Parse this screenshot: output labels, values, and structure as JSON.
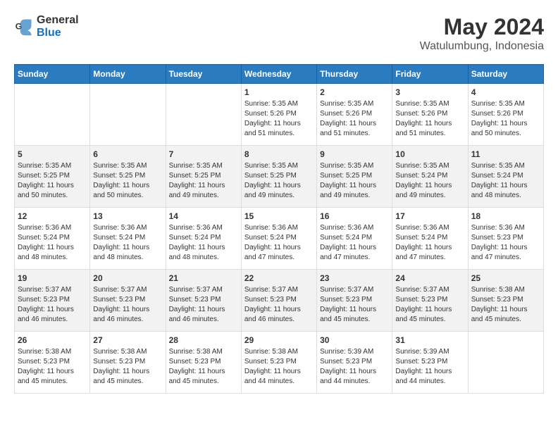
{
  "logo": {
    "general": "General",
    "blue": "Blue"
  },
  "title": "May 2024",
  "subtitle": "Watulumbung, Indonesia",
  "days": [
    "Sunday",
    "Monday",
    "Tuesday",
    "Wednesday",
    "Thursday",
    "Friday",
    "Saturday"
  ],
  "weeks": [
    [
      {
        "day": "",
        "info": ""
      },
      {
        "day": "",
        "info": ""
      },
      {
        "day": "",
        "info": ""
      },
      {
        "day": "1",
        "info": "Sunrise: 5:35 AM\nSunset: 5:26 PM\nDaylight: 11 hours\nand 51 minutes."
      },
      {
        "day": "2",
        "info": "Sunrise: 5:35 AM\nSunset: 5:26 PM\nDaylight: 11 hours\nand 51 minutes."
      },
      {
        "day": "3",
        "info": "Sunrise: 5:35 AM\nSunset: 5:26 PM\nDaylight: 11 hours\nand 51 minutes."
      },
      {
        "day": "4",
        "info": "Sunrise: 5:35 AM\nSunset: 5:26 PM\nDaylight: 11 hours\nand 50 minutes."
      }
    ],
    [
      {
        "day": "5",
        "info": "Sunrise: 5:35 AM\nSunset: 5:25 PM\nDaylight: 11 hours\nand 50 minutes."
      },
      {
        "day": "6",
        "info": "Sunrise: 5:35 AM\nSunset: 5:25 PM\nDaylight: 11 hours\nand 50 minutes."
      },
      {
        "day": "7",
        "info": "Sunrise: 5:35 AM\nSunset: 5:25 PM\nDaylight: 11 hours\nand 49 minutes."
      },
      {
        "day": "8",
        "info": "Sunrise: 5:35 AM\nSunset: 5:25 PM\nDaylight: 11 hours\nand 49 minutes."
      },
      {
        "day": "9",
        "info": "Sunrise: 5:35 AM\nSunset: 5:25 PM\nDaylight: 11 hours\nand 49 minutes."
      },
      {
        "day": "10",
        "info": "Sunrise: 5:35 AM\nSunset: 5:24 PM\nDaylight: 11 hours\nand 49 minutes."
      },
      {
        "day": "11",
        "info": "Sunrise: 5:35 AM\nSunset: 5:24 PM\nDaylight: 11 hours\nand 48 minutes."
      }
    ],
    [
      {
        "day": "12",
        "info": "Sunrise: 5:36 AM\nSunset: 5:24 PM\nDaylight: 11 hours\nand 48 minutes."
      },
      {
        "day": "13",
        "info": "Sunrise: 5:36 AM\nSunset: 5:24 PM\nDaylight: 11 hours\nand 48 minutes."
      },
      {
        "day": "14",
        "info": "Sunrise: 5:36 AM\nSunset: 5:24 PM\nDaylight: 11 hours\nand 48 minutes."
      },
      {
        "day": "15",
        "info": "Sunrise: 5:36 AM\nSunset: 5:24 PM\nDaylight: 11 hours\nand 47 minutes."
      },
      {
        "day": "16",
        "info": "Sunrise: 5:36 AM\nSunset: 5:24 PM\nDaylight: 11 hours\nand 47 minutes."
      },
      {
        "day": "17",
        "info": "Sunrise: 5:36 AM\nSunset: 5:24 PM\nDaylight: 11 hours\nand 47 minutes."
      },
      {
        "day": "18",
        "info": "Sunrise: 5:36 AM\nSunset: 5:23 PM\nDaylight: 11 hours\nand 47 minutes."
      }
    ],
    [
      {
        "day": "19",
        "info": "Sunrise: 5:37 AM\nSunset: 5:23 PM\nDaylight: 11 hours\nand 46 minutes."
      },
      {
        "day": "20",
        "info": "Sunrise: 5:37 AM\nSunset: 5:23 PM\nDaylight: 11 hours\nand 46 minutes."
      },
      {
        "day": "21",
        "info": "Sunrise: 5:37 AM\nSunset: 5:23 PM\nDaylight: 11 hours\nand 46 minutes."
      },
      {
        "day": "22",
        "info": "Sunrise: 5:37 AM\nSunset: 5:23 PM\nDaylight: 11 hours\nand 46 minutes."
      },
      {
        "day": "23",
        "info": "Sunrise: 5:37 AM\nSunset: 5:23 PM\nDaylight: 11 hours\nand 45 minutes."
      },
      {
        "day": "24",
        "info": "Sunrise: 5:37 AM\nSunset: 5:23 PM\nDaylight: 11 hours\nand 45 minutes."
      },
      {
        "day": "25",
        "info": "Sunrise: 5:38 AM\nSunset: 5:23 PM\nDaylight: 11 hours\nand 45 minutes."
      }
    ],
    [
      {
        "day": "26",
        "info": "Sunrise: 5:38 AM\nSunset: 5:23 PM\nDaylight: 11 hours\nand 45 minutes."
      },
      {
        "day": "27",
        "info": "Sunrise: 5:38 AM\nSunset: 5:23 PM\nDaylight: 11 hours\nand 45 minutes."
      },
      {
        "day": "28",
        "info": "Sunrise: 5:38 AM\nSunset: 5:23 PM\nDaylight: 11 hours\nand 45 minutes."
      },
      {
        "day": "29",
        "info": "Sunrise: 5:38 AM\nSunset: 5:23 PM\nDaylight: 11 hours\nand 44 minutes."
      },
      {
        "day": "30",
        "info": "Sunrise: 5:39 AM\nSunset: 5:23 PM\nDaylight: 11 hours\nand 44 minutes."
      },
      {
        "day": "31",
        "info": "Sunrise: 5:39 AM\nSunset: 5:23 PM\nDaylight: 11 hours\nand 44 minutes."
      },
      {
        "day": "",
        "info": ""
      }
    ]
  ]
}
